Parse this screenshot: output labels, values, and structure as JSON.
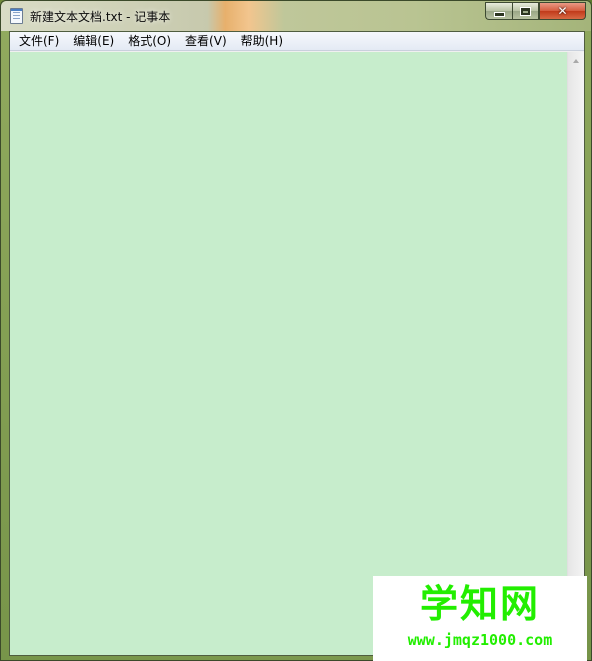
{
  "window": {
    "title": "新建文本文档.txt - 记事本"
  },
  "menu": {
    "items": [
      {
        "label": "文件(F)"
      },
      {
        "label": "编辑(E)"
      },
      {
        "label": "格式(O)"
      },
      {
        "label": "查看(V)"
      },
      {
        "label": "帮助(H)"
      }
    ]
  },
  "editor": {
    "content": "",
    "background_color": "#c7edcc"
  },
  "watermark": {
    "title": "学知网",
    "url": "www.jmqz1000.com",
    "color": "#22ee00"
  }
}
